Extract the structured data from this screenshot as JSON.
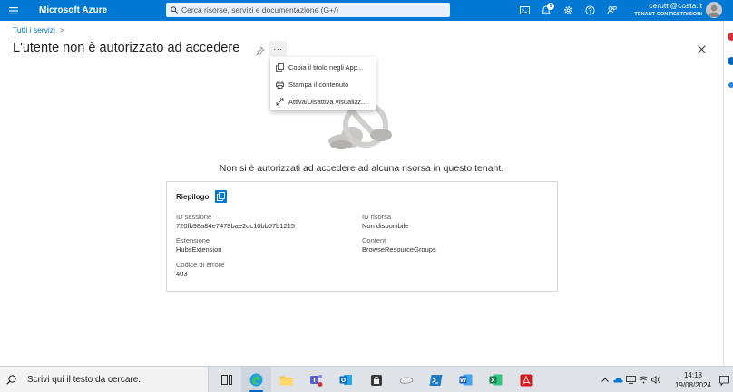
{
  "header": {
    "brand": "Microsoft Azure",
    "search_placeholder": "Cerca risorse, servizi e documentazione (G+/)",
    "notification_count": "1",
    "account_email": "cerutti@costa.it",
    "account_tenant": "TENANT CON RESTRIZIONI",
    "accent_color": "#0078d4"
  },
  "breadcrumb": {
    "root": "Tutti i servizi",
    "separator": ">"
  },
  "page": {
    "title": "L'utente non è autorizzato ad accedere",
    "more_label": "···"
  },
  "menu": {
    "items": [
      {
        "label": "Copia il titolo negli App...",
        "icon": "copy-icon"
      },
      {
        "label": "Stampa il contenuto",
        "icon": "print-icon"
      },
      {
        "label": "Attiva/Disattiva visualizz...",
        "icon": "expand-icon"
      }
    ]
  },
  "message": "Non si è autorizzati ad accedere ad alcuna risorsa in questo tenant.",
  "summary": {
    "title": "Riepilogo",
    "fields": {
      "session_label": "ID sessione",
      "session_value": "720fb98a84e7478bae2dc10bb57b1215",
      "resource_label": "ID risorsa",
      "resource_value": "Non disponibile",
      "extension_label": "Estensione",
      "extension_value": "HubsExtension",
      "content_label": "Content",
      "content_value": "BrowseResourceGroups",
      "error_label": "Codice di errore",
      "error_value": "403"
    }
  },
  "taskbar": {
    "search_text": "Scrivi qui il testo da cercare.",
    "time": "14:18",
    "date": "19/08/2024",
    "apps": [
      "task-view",
      "edge",
      "file-explorer",
      "teams",
      "outlook",
      "keepass",
      "app-7",
      "powershell",
      "word",
      "excel",
      "acrobat"
    ]
  }
}
